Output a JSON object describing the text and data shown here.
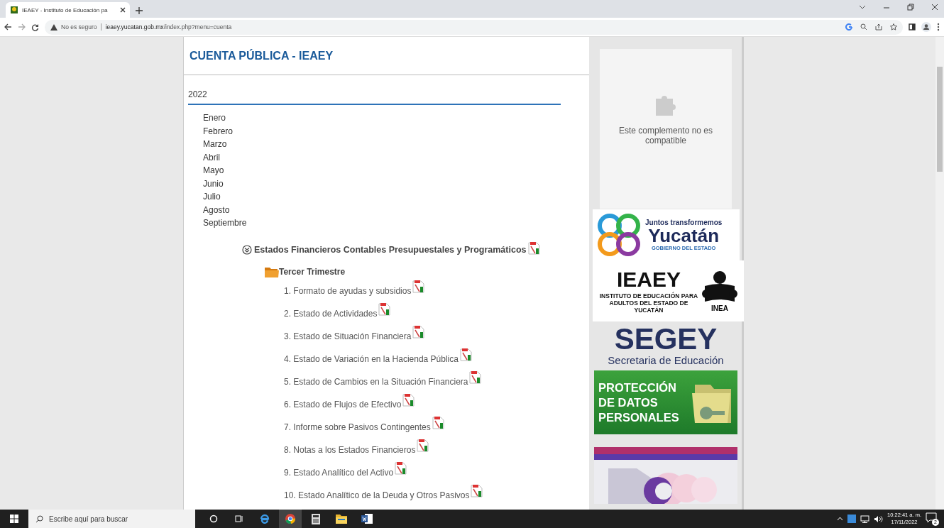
{
  "browser": {
    "tab": {
      "title": "IEAEY - Instituto de Educación pa",
      "selected": true
    },
    "security": "No es seguro",
    "url_host": "ieaey.yucatan.gob.mx",
    "url_path": "/index.php?menu=cuenta"
  },
  "page": {
    "title": "CUENTA PÚBLICA - IEAEY",
    "year": "2022",
    "months": [
      "Enero",
      "Febrero",
      "Marzo",
      "Abril",
      "Mayo",
      "Junio",
      "Julio",
      "Agosto",
      "Septiembre"
    ],
    "section": {
      "title": "Estados Financieros Contables Presupuestales y Programáticos",
      "expanded": true,
      "children": [
        {
          "title": "Tercer Trimestre",
          "children": [
            {
              "label": "1. Formato de ayudas y subsidios"
            },
            {
              "label": "2. Estado de Actividades"
            },
            {
              "label": "3. Estado de Situación Financiera"
            },
            {
              "label": "4. Estado de Variación en la Hacienda Pública"
            },
            {
              "label": "5. Estado de Cambios en la Situación Financiera"
            },
            {
              "label": "6. Estado de Flujos de Efectivo"
            },
            {
              "label": "7. Informe sobre Pasivos Contingentes"
            },
            {
              "label": "8. Notas a los Estados Financieros"
            },
            {
              "label": "9. Estado Analítico del Activo"
            },
            {
              "label": "10. Estado Analítico de la Deuda y Otros Pasivos"
            }
          ]
        }
      ]
    }
  },
  "sidebar": {
    "plugin_message": "Este complemento no es compatible",
    "banners": [
      {
        "kind": "yucatan",
        "lines": [
          "Juntos transformemos",
          "Yucatán",
          "GOBIERNO DEL ESTADO"
        ]
      },
      {
        "kind": "ieaey",
        "lines": [
          "IEAEY",
          "INSTITUTO DE EDUCACIÓN PARA ADULTOS DEL ESTADO DE YUCATÁN",
          "INEA"
        ]
      },
      {
        "kind": "segey",
        "lines": [
          "SEGEY",
          "Secretaria de Educación"
        ]
      },
      {
        "kind": "datos",
        "lines": [
          "PROTECCIÓN",
          "DE DATOS",
          "PERSONALES"
        ]
      },
      {
        "kind": "picture"
      }
    ]
  },
  "taskbar": {
    "search_placeholder": "Escribe aquí para buscar",
    "time": "10:22:41 a. m.",
    "date": "17/11/2022",
    "notifications": "2"
  }
}
